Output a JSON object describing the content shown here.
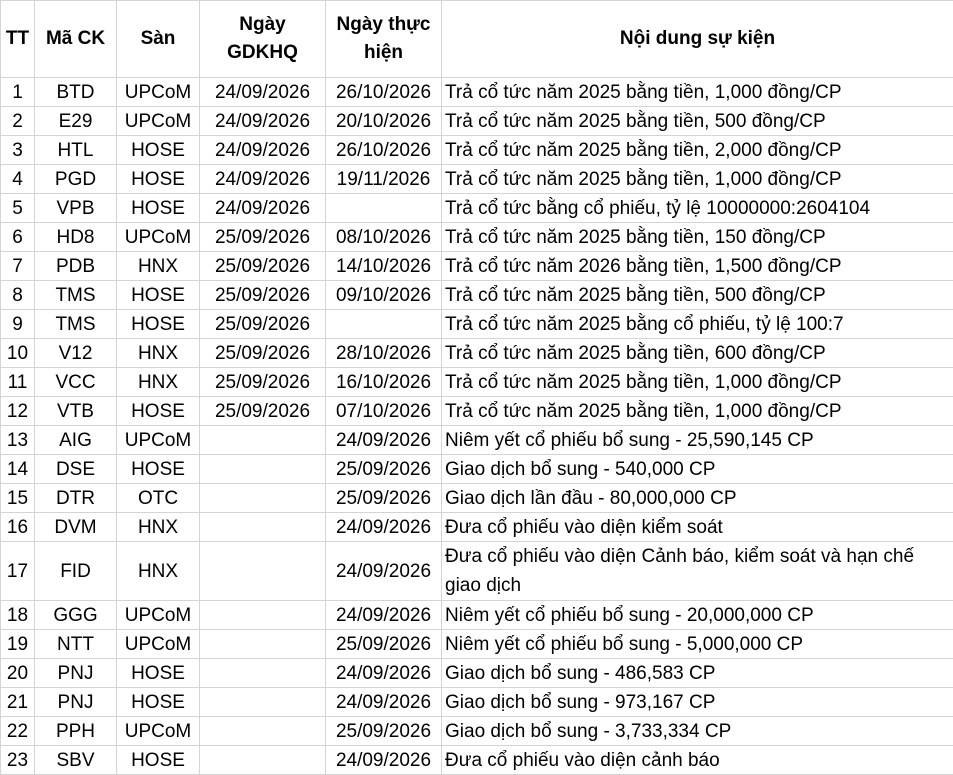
{
  "headers": {
    "tt": "TT",
    "ma_ck": "Mã CK",
    "san": "Sàn",
    "ngay_gdkhq": "Ngày GDKHQ",
    "ngay_thuc_hien": "Ngày thực hiện",
    "noi_dung": "Nội dung sự kiện"
  },
  "rows": [
    {
      "tt": "1",
      "ma": "BTD",
      "san": "UPCoM",
      "gdkhq": "24/09/2026",
      "thuc_hien": "26/10/2026",
      "noi_dung": "Trả cổ tức năm 2025 bằng tiền, 1,000 đồng/CP"
    },
    {
      "tt": "2",
      "ma": "E29",
      "san": "UPCoM",
      "gdkhq": "24/09/2026",
      "thuc_hien": "20/10/2026",
      "noi_dung": "Trả cổ tức năm 2025 bằng tiền, 500 đồng/CP"
    },
    {
      "tt": "3",
      "ma": "HTL",
      "san": "HOSE",
      "gdkhq": "24/09/2026",
      "thuc_hien": "26/10/2026",
      "noi_dung": "Trả cổ tức năm 2025 bằng tiền, 2,000 đồng/CP"
    },
    {
      "tt": "4",
      "ma": "PGD",
      "san": "HOSE",
      "gdkhq": "24/09/2026",
      "thuc_hien": "19/11/2026",
      "noi_dung": "Trả cổ tức năm 2025 bằng tiền, 1,000 đồng/CP"
    },
    {
      "tt": "5",
      "ma": "VPB",
      "san": "HOSE",
      "gdkhq": "24/09/2026",
      "thuc_hien": "",
      "noi_dung": "Trả cổ tức bằng cổ phiếu, tỷ lệ 10000000:2604104"
    },
    {
      "tt": "6",
      "ma": "HD8",
      "san": "UPCoM",
      "gdkhq": "25/09/2026",
      "thuc_hien": "08/10/2026",
      "noi_dung": "Trả cổ tức năm 2025 bằng tiền, 150 đồng/CP"
    },
    {
      "tt": "7",
      "ma": "PDB",
      "san": "HNX",
      "gdkhq": "25/09/2026",
      "thuc_hien": "14/10/2026",
      "noi_dung": "Trả cổ tức năm 2026 bằng tiền, 1,500 đồng/CP"
    },
    {
      "tt": "8",
      "ma": "TMS",
      "san": "HOSE",
      "gdkhq": "25/09/2026",
      "thuc_hien": "09/10/2026",
      "noi_dung": "Trả cổ tức năm 2025 bằng tiền, 500 đồng/CP"
    },
    {
      "tt": "9",
      "ma": "TMS",
      "san": "HOSE",
      "gdkhq": "25/09/2026",
      "thuc_hien": "",
      "noi_dung": "Trả cổ tức năm 2025 bằng cổ phiếu, tỷ lệ 100:7"
    },
    {
      "tt": "10",
      "ma": "V12",
      "san": "HNX",
      "gdkhq": "25/09/2026",
      "thuc_hien": "28/10/2026",
      "noi_dung": "Trả cổ tức năm 2025 bằng tiền, 600 đồng/CP"
    },
    {
      "tt": "11",
      "ma": "VCC",
      "san": "HNX",
      "gdkhq": "25/09/2026",
      "thuc_hien": "16/10/2026",
      "noi_dung": "Trả cổ tức năm 2025 bằng tiền, 1,000 đồng/CP"
    },
    {
      "tt": "12",
      "ma": "VTB",
      "san": "HOSE",
      "gdkhq": "25/09/2026",
      "thuc_hien": "07/10/2026",
      "noi_dung": "Trả cổ tức năm 2025 bằng tiền, 1,000 đồng/CP"
    },
    {
      "tt": "13",
      "ma": "AIG",
      "san": "UPCoM",
      "gdkhq": "",
      "thuc_hien": "24/09/2026",
      "noi_dung": "Niêm yết cổ phiếu bổ sung - 25,590,145 CP"
    },
    {
      "tt": "14",
      "ma": "DSE",
      "san": "HOSE",
      "gdkhq": "",
      "thuc_hien": "25/09/2026",
      "noi_dung": "Giao dịch bổ sung - 540,000 CP"
    },
    {
      "tt": "15",
      "ma": "DTR",
      "san": "OTC",
      "gdkhq": "",
      "thuc_hien": "25/09/2026",
      "noi_dung": "Giao dịch lần đầu - 80,000,000 CP"
    },
    {
      "tt": "16",
      "ma": "DVM",
      "san": "HNX",
      "gdkhq": "",
      "thuc_hien": "24/09/2026",
      "noi_dung": "Đưa cổ phiếu vào diện kiểm soát"
    },
    {
      "tt": "17",
      "ma": "FID",
      "san": "HNX",
      "gdkhq": "",
      "thuc_hien": "24/09/2026",
      "noi_dung": "Đưa cổ phiếu vào diện Cảnh báo, kiểm soát và hạn chế giao dịch"
    },
    {
      "tt": "18",
      "ma": "GGG",
      "san": "UPCoM",
      "gdkhq": "",
      "thuc_hien": "24/09/2026",
      "noi_dung": "Niêm yết cổ phiếu bổ sung - 20,000,000 CP"
    },
    {
      "tt": "19",
      "ma": "NTT",
      "san": "UPCoM",
      "gdkhq": "",
      "thuc_hien": "25/09/2026",
      "noi_dung": "Niêm yết cổ phiếu bổ sung - 5,000,000 CP"
    },
    {
      "tt": "20",
      "ma": "PNJ",
      "san": "HOSE",
      "gdkhq": "",
      "thuc_hien": "24/09/2026",
      "noi_dung": "Giao dịch bổ sung - 486,583 CP"
    },
    {
      "tt": "21",
      "ma": "PNJ",
      "san": "HOSE",
      "gdkhq": "",
      "thuc_hien": "24/09/2026",
      "noi_dung": "Giao dịch bổ sung - 973,167 CP"
    },
    {
      "tt": "22",
      "ma": "PPH",
      "san": "UPCoM",
      "gdkhq": "",
      "thuc_hien": "25/09/2026",
      "noi_dung": "Giao dịch bổ sung - 3,733,334 CP"
    },
    {
      "tt": "23",
      "ma": "SBV",
      "san": "HOSE",
      "gdkhq": "",
      "thuc_hien": "24/09/2026",
      "noi_dung": "Đưa cổ phiếu vào diện cảnh báo"
    }
  ],
  "colors": {
    "grid": "#d4d4d4",
    "text": "#000000",
    "background": "#ffffff"
  }
}
